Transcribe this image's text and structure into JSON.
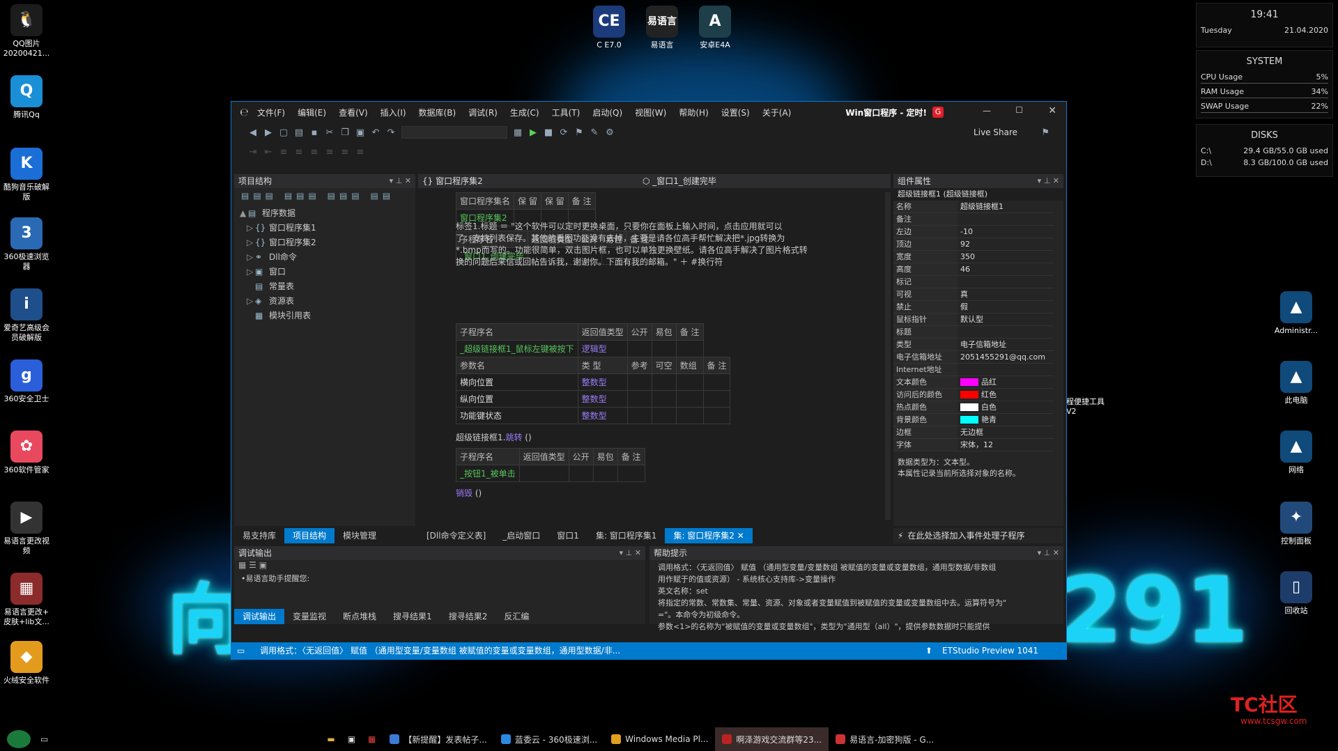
{
  "desktop": {
    "left_icons": [
      {
        "label": "QQ图片\n20200421...",
        "glyph": "🐧",
        "color": "#1c1c1c"
      },
      {
        "label": "腾讯Qq",
        "glyph": "Q",
        "color": "#1a8fd6"
      },
      {
        "label": "酷狗音乐破解\n版",
        "glyph": "K",
        "color": "#1a6ed6"
      },
      {
        "label": "360极速浏览\n器",
        "glyph": "3",
        "color": "#2a6ab5"
      },
      {
        "label": "爱奇艺高级会\n员破解版",
        "glyph": "i",
        "color": "#1e4f8a"
      },
      {
        "label": "360安全卫士",
        "glyph": "g",
        "color": "#2b5fd9"
      },
      {
        "label": "360软件管家",
        "glyph": "✿",
        "color": "#e8495e"
      },
      {
        "label": "易语言更改视\n频",
        "glyph": "▶",
        "color": "#333"
      },
      {
        "label": "易语言更改+\n皮肤+lib文...",
        "glyph": "▦",
        "color": "#8b2b2b"
      },
      {
        "label": "火绒安全软件",
        "glyph": "◆",
        "color": "#e39b1e"
      }
    ],
    "top_icons": [
      {
        "label": "C E7.0",
        "glyph": "CE",
        "color": "#1b3b7a"
      },
      {
        "label": "易语言",
        "glyph": "易语言",
        "color": "#222"
      },
      {
        "label": "安卓E4A",
        "glyph": "A",
        "color": "#1e3f4a"
      }
    ],
    "right_icons": [
      {
        "label": "Administr...",
        "glyph": "▲",
        "color": "#0f4a7a"
      },
      {
        "label": "此电脑",
        "glyph": "▲",
        "color": "#0f4a7a"
      },
      {
        "label": "网络",
        "glyph": "▲",
        "color": "#0f4a7a"
      },
      {
        "label": "控制面板",
        "glyph": "✦",
        "color": "#214a7a"
      },
      {
        "label": "回收站",
        "glyph": "▯",
        "color": "#1d3c6a"
      }
    ],
    "big_text_left": "向",
    "big_text_right": "291",
    "side_label": "程便捷工具\nV2"
  },
  "widget": {
    "time": "19:41",
    "day": "Tuesday",
    "date": "21.04.2020",
    "system_title": "SYSTEM",
    "stats": [
      {
        "label": "CPU Usage",
        "value": "5%"
      },
      {
        "label": "RAM Usage",
        "value": "34%"
      },
      {
        "label": "SWAP Usage",
        "value": "22%"
      }
    ],
    "disks_title": "DISKS",
    "disks": [
      {
        "label": "C:\\",
        "value": "29.4 GB/55.0 GB used"
      },
      {
        "label": "D:\\",
        "value": "8.3 GB/100.0 GB used"
      }
    ]
  },
  "ide": {
    "menu": [
      "文件(F)",
      "编辑(E)",
      "查看(V)",
      "插入(I)",
      "数据库(B)",
      "调试(R)",
      "生成(C)",
      "工具(T)",
      "启动(Q)",
      "视图(W)",
      "帮助(H)",
      "设置(S)",
      "关于(A)"
    ],
    "title": "Win窗口程序 - 定时!",
    "live_share": "Live Share",
    "project_panel": {
      "title": "项目结构",
      "tree": [
        {
          "label": "程序数据",
          "indent": 0,
          "arrow": "▲",
          "icon": "▤"
        },
        {
          "label": "窗口程序集1",
          "indent": 1,
          "arrow": "▷",
          "icon": "{}"
        },
        {
          "label": "窗口程序集2",
          "indent": 1,
          "arrow": "▷",
          "icon": "{}"
        },
        {
          "label": "Dll命令",
          "indent": 1,
          "arrow": "▷",
          "icon": "⚭"
        },
        {
          "label": "窗口",
          "indent": 1,
          "arrow": "▷",
          "icon": "▣"
        },
        {
          "label": "常量表",
          "indent": 1,
          "arrow": "",
          "icon": "▤"
        },
        {
          "label": "资源表",
          "indent": 1,
          "arrow": "▷",
          "icon": "◈"
        },
        {
          "label": "模块引用表",
          "indent": 1,
          "arrow": "",
          "icon": "▦"
        }
      ],
      "bottom_tabs": [
        "易支持库",
        "项目结构",
        "模块管理"
      ]
    },
    "editor": {
      "nav_left": "{} 窗口程序集2",
      "nav_right": "⬡ _窗口1_创建完毕",
      "assembly_table": {
        "headers": [
          "窗口程序集名",
          "保 留",
          "保 留",
          "备 注"
        ],
        "row": [
          "窗口程序集2",
          "",
          "",
          ""
        ]
      },
      "sub1_table": {
        "headers": [
          "子程序名",
          "返回值类型",
          "公开",
          "易包",
          "备 注"
        ],
        "row": [
          "_窗口1_创建完毕",
          "",
          "",
          "",
          ""
        ]
      },
      "code_lines": [
        "标签1.标题  ＝  \"这个软件可以定时更换桌面，只要你在面板上输入时间，点击应用就可以",
        "了，支持列表保存。其他的看图功能没有去掉，主要是请各位高手帮忙解决把*.jpg转换为",
        "*.bmp而写的。功能很简单，双击图片框，也可以单独更换壁纸。请各位高手解决了图片格式转",
        "换的问题后来信或回帖告诉我，谢谢你。下面有我的邮箱。\"  ＋  #换行符"
      ],
      "sub2_table": {
        "headers": [
          "子程序名",
          "返回值类型",
          "公开",
          "易包",
          "备 注"
        ],
        "row": [
          "_超级链接框1_鼠标左键被按下",
          "逻辑型",
          "",
          "",
          ""
        ],
        "param_headers": [
          "参数名",
          "类 型",
          "参考",
          "可空",
          "数组",
          "备 注"
        ],
        "params": [
          [
            "横向位置",
            "整数型",
            "",
            "",
            "",
            ""
          ],
          [
            "纵向位置",
            "整数型",
            "",
            "",
            "",
            ""
          ],
          [
            "功能键状态",
            "整数型",
            "",
            "",
            "",
            ""
          ]
        ]
      },
      "call_line_obj": "超级链接框1.",
      "call_line_method": "跳转",
      "call_line_args": " ()",
      "sub3_table": {
        "headers": [
          "子程序名",
          "返回值类型",
          "公开",
          "易包",
          "备 注"
        ],
        "row": [
          "_按钮1_被单击",
          "",
          "",
          "",
          ""
        ]
      },
      "last_line_kw": "销毁",
      "last_line_args": " ()",
      "doc_tabs": [
        "[Dll命令定义表]",
        "_启动窗口",
        "窗口1",
        "集: 窗口程序集1",
        "集: 窗口程序集2"
      ]
    },
    "props_panel": {
      "title": "组件属性",
      "component": "超级链接框1 (超级链接框)",
      "rows": [
        {
          "k": "名称",
          "v": "超级链接框1",
          "c": ""
        },
        {
          "k": "备注",
          "v": "",
          "c": ""
        },
        {
          "k": "左边",
          "v": "-10",
          "c": ""
        },
        {
          "k": "顶边",
          "v": "92",
          "c": ""
        },
        {
          "k": "宽度",
          "v": "350",
          "c": ""
        },
        {
          "k": "高度",
          "v": "46",
          "c": ""
        },
        {
          "k": "标记",
          "v": "",
          "c": ""
        },
        {
          "k": "可视",
          "v": "真",
          "c": ""
        },
        {
          "k": "禁止",
          "v": "假",
          "c": ""
        },
        {
          "k": "鼠标指针",
          "v": "默认型",
          "c": ""
        },
        {
          "k": "标题",
          "v": "",
          "c": ""
        },
        {
          "k": "类型",
          "v": "电子信箱地址",
          "c": ""
        },
        {
          "k": "  电子信箱地址",
          "v": "2051455291@qq.com",
          "c": ""
        },
        {
          "k": "  Internet地址",
          "v": "",
          "c": ""
        },
        {
          "k": "文本颜色",
          "v": "品红",
          "c": "#ff00ff"
        },
        {
          "k": "访问后的颜色",
          "v": "红色",
          "c": "#ff0000"
        },
        {
          "k": "热点颜色",
          "v": "白色",
          "c": "#ffffff"
        },
        {
          "k": "背景颜色",
          "v": "艳青",
          "c": "#00ffff"
        },
        {
          "k": "边框",
          "v": "无边框",
          "c": ""
        },
        {
          "k": "字体",
          "v": "宋体，12",
          "c": ""
        }
      ],
      "desc_line1": "数据类型为：文本型。",
      "desc_line2": "本属性记录当前所选择对象的名称。",
      "event_hint": "在此处选择加入事件处理子程序"
    },
    "debug_panel": {
      "title": "调试输出",
      "line": "•易语言助手提醒您:",
      "tabs": [
        "调试输出",
        "变量监视",
        "断点堆栈",
        "搜寻结果1",
        "搜寻结果2",
        "反汇编"
      ]
    },
    "help_panel": {
      "title": "帮助提示",
      "lines": [
        "调用格式：〈无返回值〉 赋值 （通用型变量/变量数组 被赋值的变量或变量数组，通用型数据/非数组",
        "用作赋于的值或资源） - 系统核心支持库->变量操作",
        "英文名称：set",
        "将指定的常数、常数集、常量、资源、对象或者变量赋值到被赋值的变量或变量数组中去。运算符号为\"",
        "=\"。本命令为初级命令。",
        "参数<1>的名称为\"被赋值的变量或变量数组\"，类型为\"通用型（all）\"，提供参数数据时只能提供"
      ]
    },
    "status": {
      "text": "调用格式：〈无返回值〉 赋值 （通用型变量/变量数组 被赋值的变量或变量数组，通用型数据/非...",
      "right": "ETStudio Preview 1041"
    }
  },
  "taskbar": {
    "items": [
      {
        "label": "【新提醒】发表帖子...",
        "color": "#3b7bd6",
        "active": false
      },
      {
        "label": "蓝委云 - 360极速浏...",
        "color": "#2a8ae0",
        "active": false
      },
      {
        "label": "Windows Media Pl...",
        "color": "#e0a020",
        "active": false
      },
      {
        "label": "啊泽游戏交流群等23...",
        "color": "#b22",
        "active": true
      },
      {
        "label": "易语言-加密狗版 - G...",
        "color": "#c33",
        "active": false
      }
    ],
    "watermark": "TC社区",
    "watermark_url": "www.tcsgw.com"
  }
}
